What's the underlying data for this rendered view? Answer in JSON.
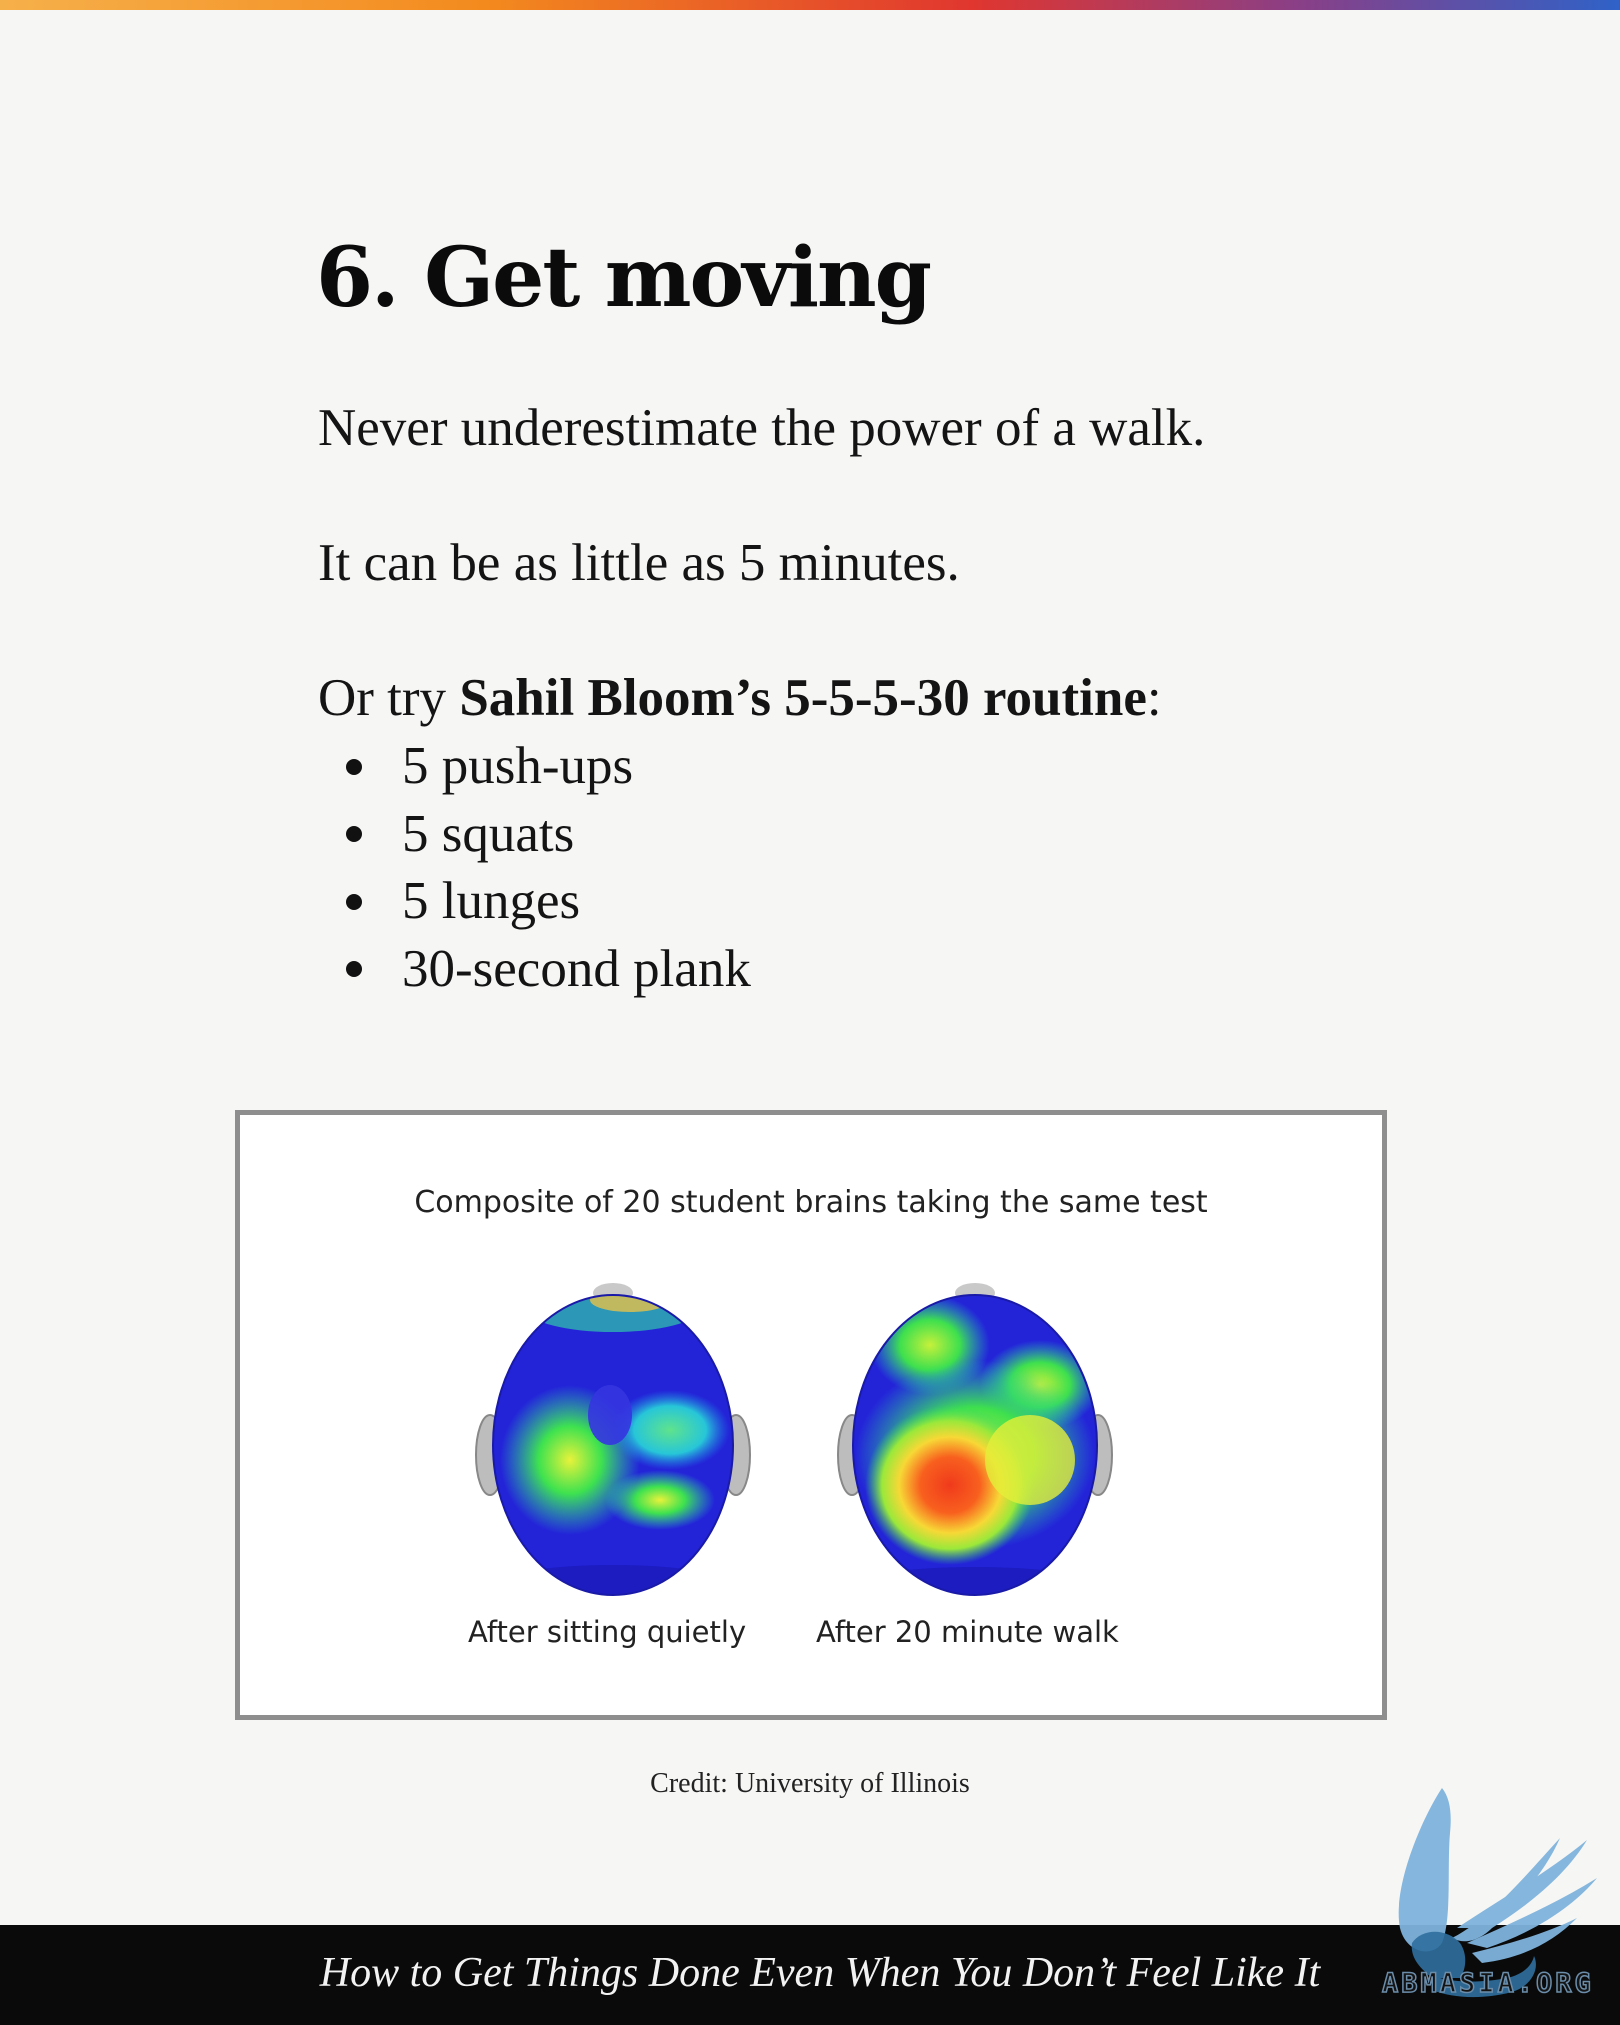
{
  "heading": "6. Get moving",
  "paragraphs": {
    "p1": "Never underestimate the power of a walk.",
    "p2": "It can be as little as 5 minutes.",
    "p3_prefix": "Or try ",
    "p3_bold": "Sahil Bloom’s 5-5-5-30 routine",
    "p3_suffix": ":"
  },
  "routine": [
    "5 push-ups",
    "5 squats",
    "5 lunges",
    "30-second plank"
  ],
  "figure": {
    "title": "Composite of 20 student brains taking the same test",
    "left_label": "After sitting quietly",
    "right_label": "After 20 minute walk",
    "icon": "brain-scan-heatmap"
  },
  "credit": "Credit: University of Illinois",
  "footer": {
    "title": "How to Get Things Done Even When You Don’t Feel Like It"
  },
  "watermark": {
    "text": "ABMASIA.ORG",
    "icon": "griffin-logo-icon",
    "color": "#7fb3dc"
  },
  "colors": {
    "top_bar": [
      "#f6b04a",
      "#f38a1e",
      "#e0362f",
      "#8a3f86",
      "#2f62c8"
    ],
    "footer_bg": "#0a0a0a"
  }
}
